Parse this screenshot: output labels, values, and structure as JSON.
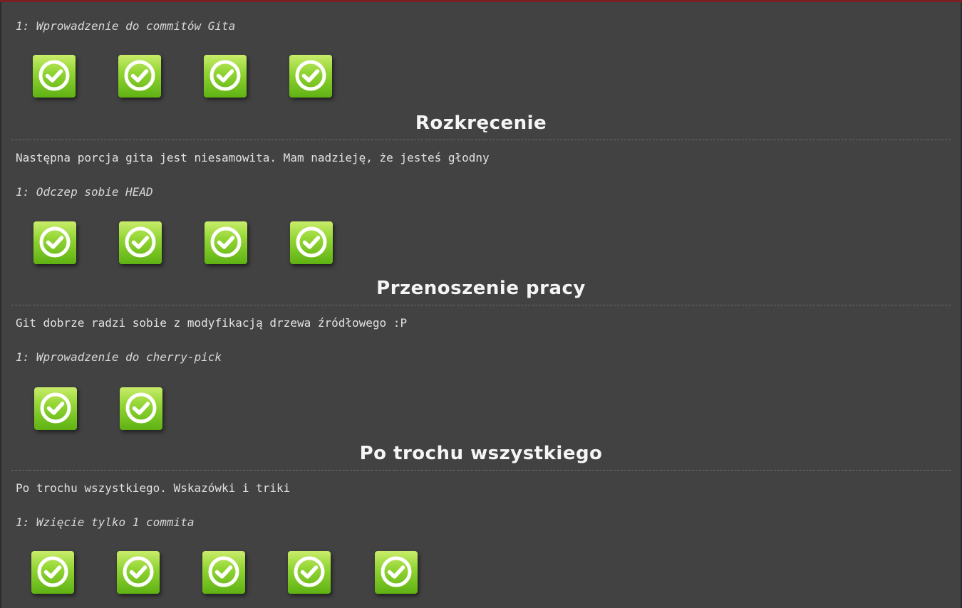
{
  "sections": [
    {
      "title": "",
      "about": "",
      "level_name": "1: Wprowadzenie do commitów Gita",
      "level_count": 4
    },
    {
      "title": "Rozkręcenie",
      "about": "Następna porcja gita jest niesamowita. Mam nadzieję, że jesteś głodny",
      "level_name": "1: Odczep sobie HEAD",
      "level_count": 4
    },
    {
      "title": "Przenoszenie pracy",
      "about": "Git dobrze radzi sobie z modyfikacją drzewa źródłowego :P",
      "level_name": "1: Wprowadzenie do cherry-pick",
      "level_count": 2
    },
    {
      "title": "Po trochu wszystkiego",
      "about": "Po trochu wszystkiego. Wskazówki i triki",
      "level_name": "1: Wzięcie tylko 1 commita",
      "level_count": 5
    }
  ],
  "icon": "check-circle-icon",
  "colors": {
    "background": "#424242",
    "accent_top": "#7a1f24",
    "icon_light": "#c9ec6b",
    "icon_dark": "#5fb214"
  }
}
